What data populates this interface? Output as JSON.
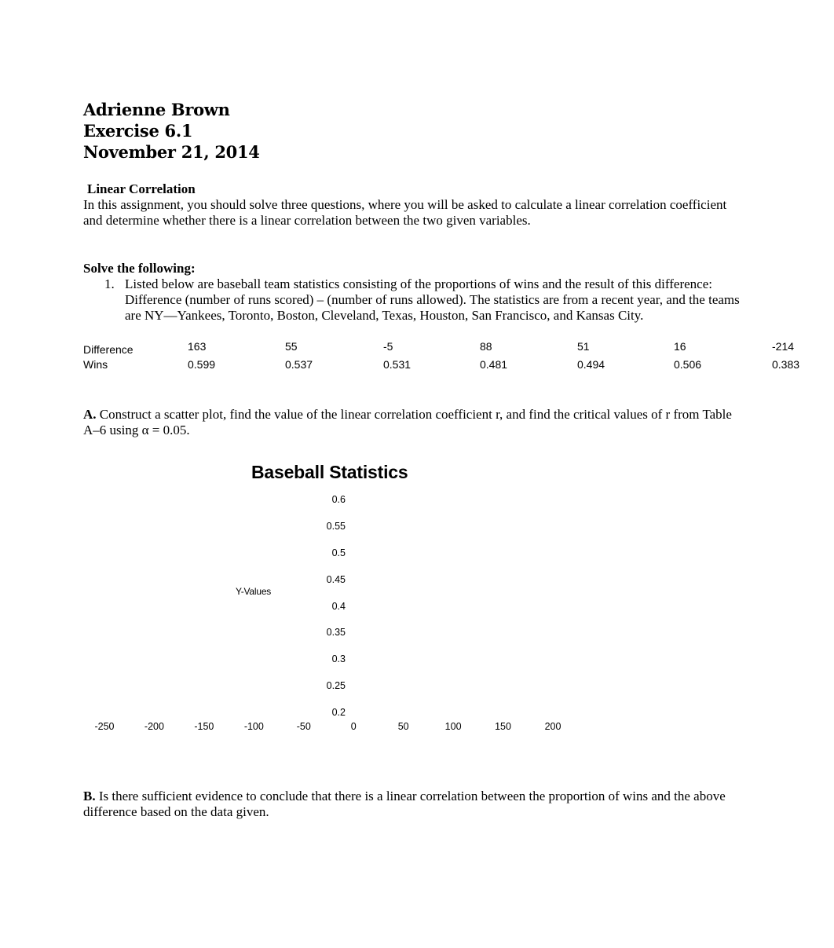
{
  "header": {
    "name": "Adrienne Brown",
    "exercise": "Exercise 6.1",
    "date": "November 21, 2014"
  },
  "intro": {
    "title": "Linear Correlation",
    "text": "In this assignment, you should solve three questions, where you will be asked to calculate a linear correlation coefficient and determine whether there is a linear correlation between the two given variables."
  },
  "solve": {
    "title": "Solve the following:",
    "items": [
      {
        "number": "1.",
        "text": "Listed below are baseball team statistics consisting of the proportions of wins and the result of this difference: Difference (number of runs scored) – (number of runs allowed). The statistics are from a recent year, and the teams are NY—Yankees, Toronto, Boston, Cleveland, Texas, Houston, San Francisco, and Kansas City."
      }
    ]
  },
  "table": {
    "rows": [
      {
        "label": "Difference",
        "values": [
          "163",
          "55",
          "-5",
          "88",
          "51",
          "16",
          "-214"
        ]
      },
      {
        "label": "Wins",
        "values": [
          "0.599",
          "0.537",
          "0.531",
          "0.481",
          "0.494",
          "0.506",
          "0.383"
        ]
      }
    ]
  },
  "question_a": {
    "label": "A.",
    "text": " Construct a scatter plot, find the value of the linear correlation coefficient r, and find the critical values of r from Table A–6 using α = 0.05."
  },
  "question_b": {
    "label": "B.",
    "text": " Is there sufficient evidence to conclude that there is a linear correlation between the proportion of wins and the above difference based on the data given."
  },
  "chart_data": {
    "type": "scatter",
    "title": "Baseball Statistics",
    "xlabel": "",
    "ylabel": "Y-Values",
    "xlim": [
      -250,
      200
    ],
    "ylim": [
      0.2,
      0.6
    ],
    "x_ticks": [
      "-250",
      "-200",
      "-150",
      "-100",
      "-50",
      "0",
      "50",
      "100",
      "150",
      "200"
    ],
    "y_ticks": [
      "0.6",
      "0.55",
      "0.5",
      "0.45",
      "0.4",
      "0.35",
      "0.3",
      "0.25",
      "0.2"
    ],
    "grid": false,
    "legend": "none",
    "series": [
      {
        "name": "Y-Values",
        "points": [],
        "visible_markers": false
      }
    ]
  }
}
